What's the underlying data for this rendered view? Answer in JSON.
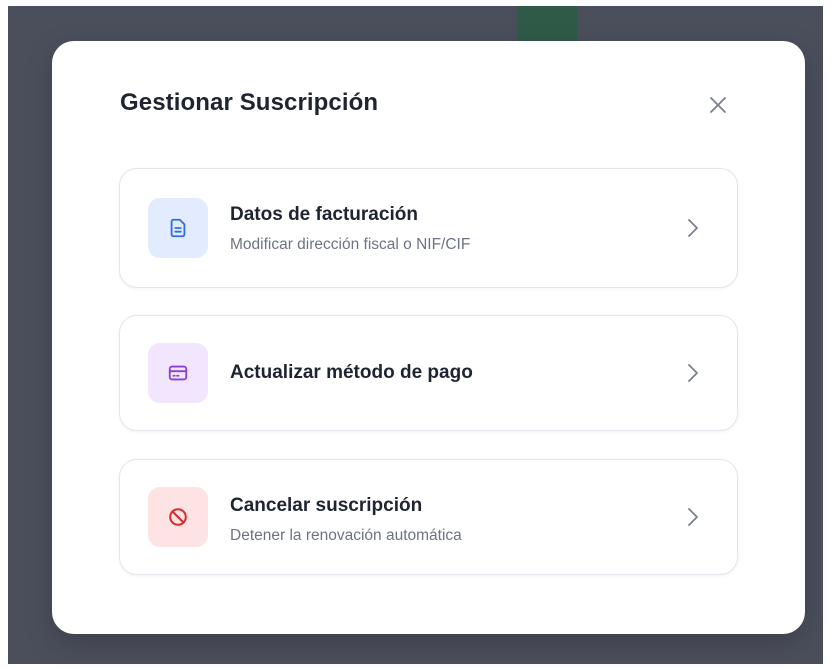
{
  "modal": {
    "title": "Gestionar Suscripción",
    "close_icon": "close-icon"
  },
  "options": [
    {
      "title": "Datos de facturación",
      "description": "Modificar dirección fiscal o NIF/CIF",
      "icon": "document-icon",
      "color": "#2f6fe4",
      "bg": "#e2ecfe"
    },
    {
      "title": "Actualizar método de pago",
      "description": "",
      "icon": "credit-card-icon",
      "color": "#8b3fd9",
      "bg": "#f1e6fd"
    },
    {
      "title": "Cancelar suscripción",
      "description": "Detener la renovación automática",
      "icon": "cancel-icon",
      "color": "#d62c2c",
      "bg": "#fde3e3"
    }
  ]
}
